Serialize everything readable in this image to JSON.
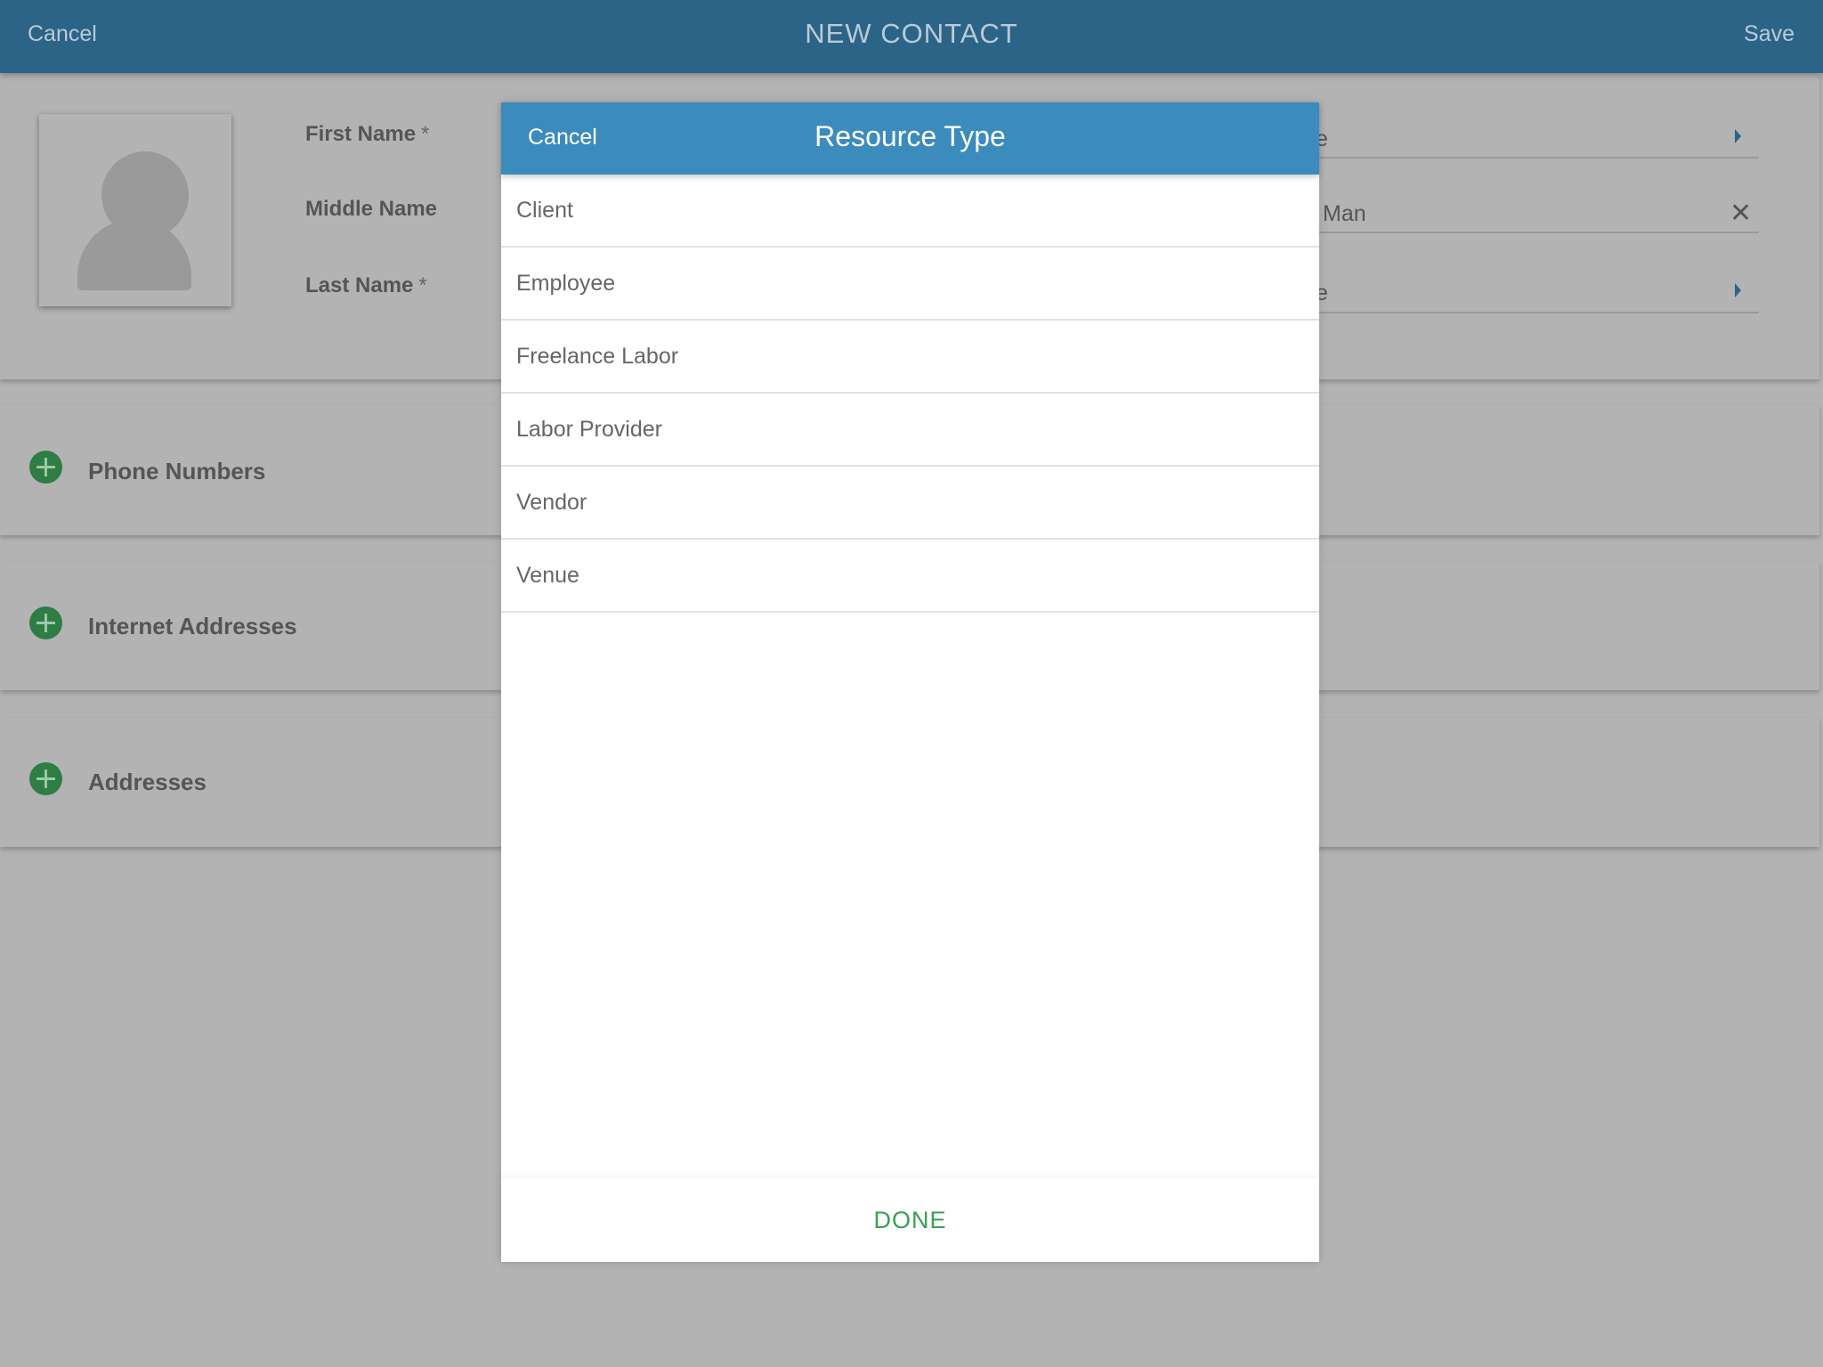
{
  "topbar": {
    "cancel_label": "Cancel",
    "title": "NEW CONTACT",
    "save_label": "Save"
  },
  "form": {
    "first_name_label": "First Name",
    "middle_name_label": "Middle Name",
    "last_name_label": "Last Name",
    "required_mark": "*",
    "right_values": {
      "row1_partial": "e",
      "row2_partial": "Man",
      "row3_partial": "e"
    }
  },
  "sections": {
    "phone_numbers": "Phone Numbers",
    "internet_addresses": "Internet Addresses",
    "addresses": "Addresses"
  },
  "modal": {
    "cancel_label": "Cancel",
    "title": "Resource Type",
    "options": [
      "Client",
      "Employee",
      "Freelance Labor",
      "Labor Provider",
      "Vendor",
      "Venue"
    ],
    "done_label": "DONE"
  },
  "colors": {
    "topbar": "#2b6487",
    "modal_header": "#3c8bbd",
    "add_icon": "#2e7d44",
    "done": "#3aa150",
    "overlay": "#b3b3b3"
  }
}
